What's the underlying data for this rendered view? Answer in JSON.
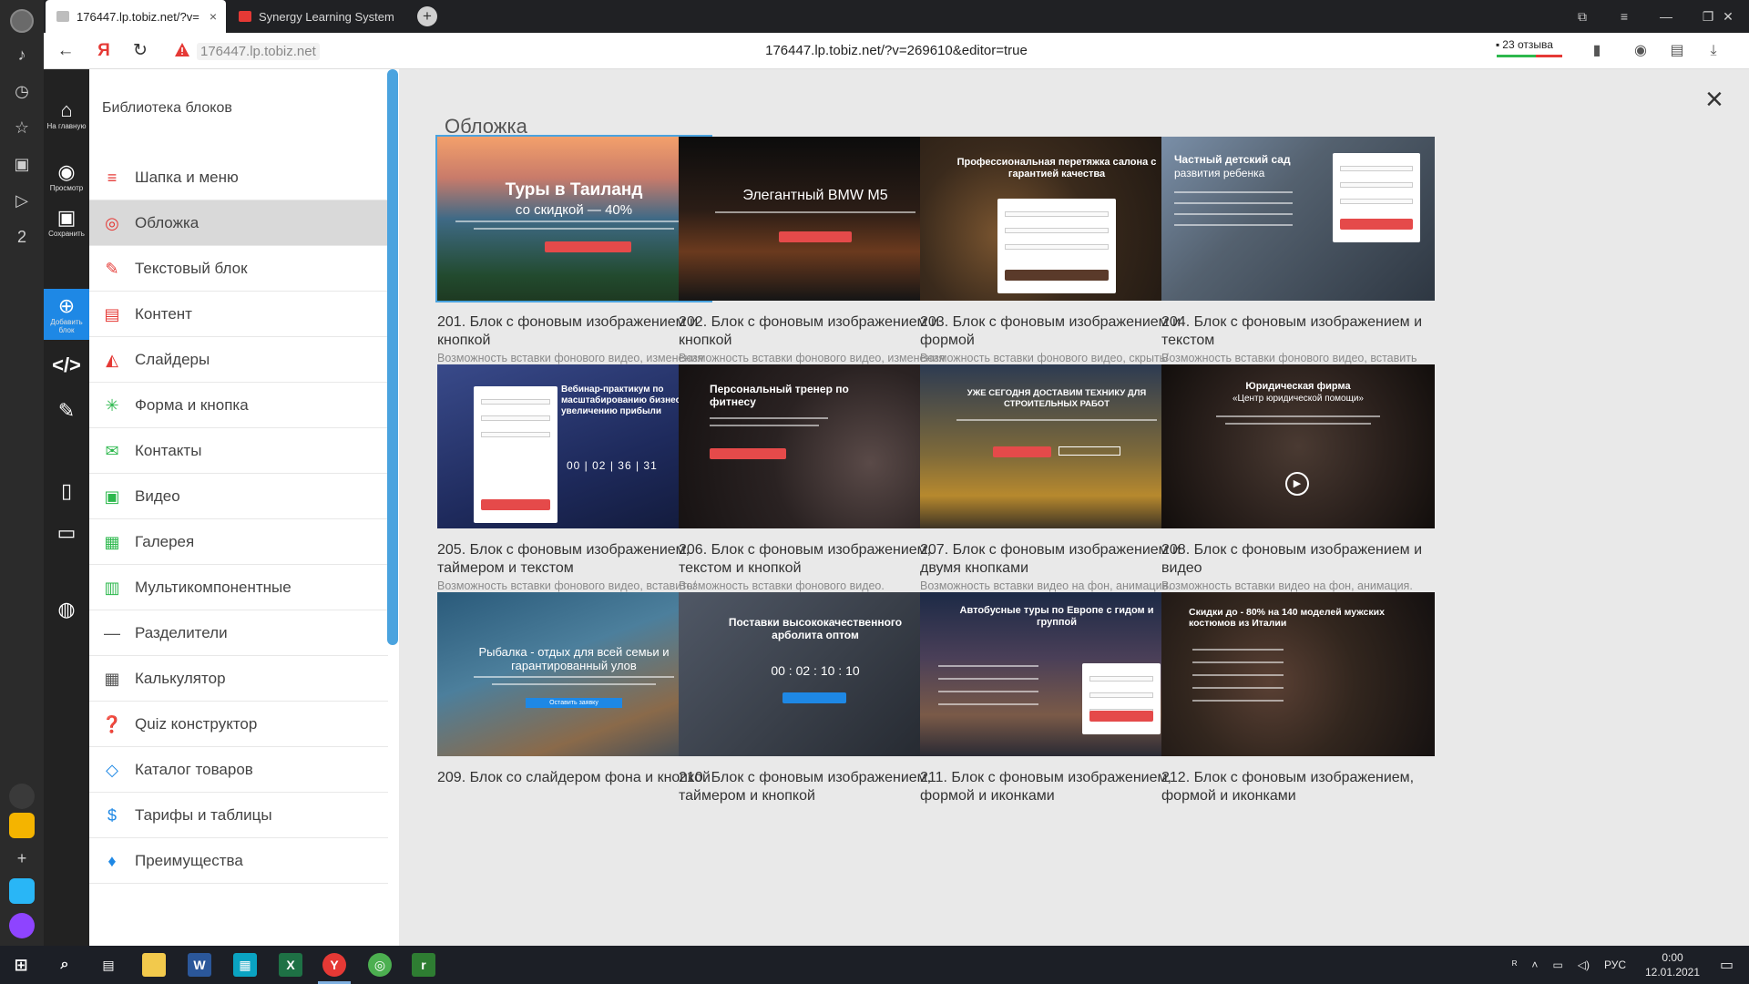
{
  "browser": {
    "tabs": [
      {
        "label": "176447.lp.tobiz.net/?v=",
        "active": true,
        "close": "×"
      },
      {
        "label": "Synergy Learning System",
        "active": false
      }
    ],
    "new_tab": "+",
    "short_url": "176447.lp.tobiz.net",
    "full_url": "176447.lp.tobiz.net/?v=269610&editor=true",
    "reviews": "23 отзыва",
    "yandex_logo": "Я",
    "nav": {
      "back": "←",
      "reload": "↻"
    }
  },
  "editor": {
    "home_label": "На главную",
    "preview_label": "Просмотр",
    "save_label": "Сохранить",
    "add_label": "Добавить блок"
  },
  "library": {
    "title": "Библиотека блоков",
    "items": [
      {
        "label": "Шапка и меню",
        "icon": "menu-icon",
        "color": "#e53935"
      },
      {
        "label": "Обложка",
        "icon": "target-icon",
        "color": "#e53935",
        "active": true
      },
      {
        "label": "Текстовый блок",
        "icon": "text-edit-icon",
        "color": "#e53935"
      },
      {
        "label": "Контент",
        "icon": "content-icon",
        "color": "#e53935"
      },
      {
        "label": "Слайдеры",
        "icon": "slider-icon",
        "color": "#e53935"
      },
      {
        "label": "Форма и кнопка",
        "icon": "pointer-icon",
        "color": "#2db84d"
      },
      {
        "label": "Контакты",
        "icon": "envelope-icon",
        "color": "#2db84d"
      },
      {
        "label": "Видео",
        "icon": "video-icon",
        "color": "#2db84d"
      },
      {
        "label": "Галерея",
        "icon": "gallery-icon",
        "color": "#2db84d"
      },
      {
        "label": "Мультикомпонентные",
        "icon": "multi-icon",
        "color": "#2db84d"
      },
      {
        "label": "Разделители",
        "icon": "divider-icon",
        "color": "#555555"
      },
      {
        "label": "Калькулятор",
        "icon": "calculator-icon",
        "color": "#555555"
      },
      {
        "label": "Quiz конструктор",
        "icon": "quiz-icon",
        "color": "#555555"
      },
      {
        "label": "Каталог товаров",
        "icon": "basket-icon",
        "color": "#1e88e5"
      },
      {
        "label": "Тарифы и таблицы",
        "icon": "dollar-icon",
        "color": "#1e88e5"
      },
      {
        "label": "Преимущества",
        "icon": "diamond-icon",
        "color": "#1e88e5"
      }
    ]
  },
  "gallery": {
    "title": "Обложка",
    "close": "×",
    "cards": [
      {
        "title": "201. Блок с фоновым изображением и кнопкой",
        "desc": "Возможность вставки фонового видео, изменения размера кнопки, вставка формы вместо кнопки.",
        "thumb_head": "Туры в Таиланд",
        "thumb_sub": "со скидкой — 40%"
      },
      {
        "title": "202. Блок с фоновым изображением и кнопкой",
        "desc": "Возможность вставки фонового видео, изменения размера кнопки, скрыть/вставить форму.",
        "thumb_head": "Элегантный BMW M5",
        "thumb_sub": ""
      },
      {
        "title": "203. Блок с фоновым изображением и формой",
        "desc": "Возможность вставки фонового видео, скрыть/вставить кнопку.",
        "thumb_head": "Профессиональная перетяжка салона с гарантией качества",
        "thumb_sub": ""
      },
      {
        "title": "204. Блок с фоновым изображением и текстом",
        "desc": "Возможность вставки фонового видео, вставить таймер, изменение местоположения формы.",
        "thumb_head": "Частный детский сад",
        "thumb_sub": "развития ребенка"
      },
      {
        "title": "205. Блок с фоновым изображением, таймером и текстом",
        "desc": "Возможность вставки фонового видео, вставить/убрать таймер, изменение местоположения формы.",
        "thumb_head": "Вебинар-практикум по масштабированию бизнеса и увеличению прибыли",
        "thumb_sub": "00 | 02 | 36 | 31"
      },
      {
        "title": "206. Блок с фоновым изображением, текстом и кнопкой",
        "desc": "Возможность вставки фонового видео.",
        "thumb_head": "Персональный тренер по фитнесу",
        "thumb_sub": ""
      },
      {
        "title": "207. Блок с фоновым изображением и двумя кнопками",
        "desc": "Возможность вставки видео на фон, анимация.",
        "thumb_head": "УЖЕ СЕГОДНЯ ДОСТАВИМ ТЕХНИКУ ДЛЯ СТРОИТЕЛЬНЫХ РАБОТ",
        "thumb_sub": ""
      },
      {
        "title": "208. Блок с фоновым изображением и видео",
        "desc": "Возможность вставки видео на фон, анимация.",
        "thumb_head": "Юридическая фирма",
        "thumb_sub": "«Центр юридической помощи»"
      },
      {
        "title": "209. Блок со слайдером фона и кнопкой",
        "desc": "",
        "thumb_head": "Рыбалка - отдых для всей семьи и гарантированный улов",
        "thumb_sub": "Оставить заявку"
      },
      {
        "title": "210. Блок с фоновым изображением, таймером и кнопкой",
        "desc": "",
        "thumb_head": "Поставки высококачественного арболита оптом",
        "thumb_sub": "00 : 02 : 10 : 10"
      },
      {
        "title": "211. Блок с фоновым изображением, формой и иконками",
        "desc": "",
        "thumb_head": "Автобусные туры по Европе с гидом и группой",
        "thumb_sub": ""
      },
      {
        "title": "212. Блок с фоновым изображением, формой и иконками",
        "desc": "",
        "thumb_head": "Скидки до - 80% на 140 моделей мужских костюмов из Италии",
        "thumb_sub": ""
      }
    ]
  },
  "taskbar": {
    "lang": "РУС",
    "time": "0:00",
    "date": "12.01.2021"
  },
  "colors": {
    "accent_blue": "#4aa3df",
    "editor_bar": "#222222",
    "add_block": "#1e88e5",
    "thumb_button": "#e54a4a"
  }
}
